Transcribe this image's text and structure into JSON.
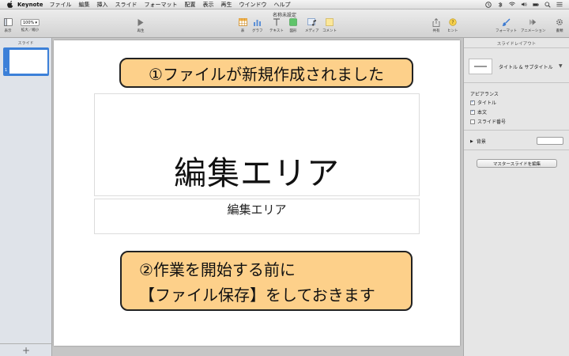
{
  "menubar": {
    "app_name": "Keynote",
    "items": [
      "ファイル",
      "編集",
      "挿入",
      "スライド",
      "フォーマット",
      "配置",
      "表示",
      "再生",
      "ウインドウ",
      "ヘルプ"
    ],
    "status_icons": [
      "clock-icon",
      "bluetooth-icon",
      "wifi-icon",
      "volume-icon",
      "battery-icon",
      "spotlight-icon",
      "notification-icon"
    ]
  },
  "window": {
    "title": "名称未設定"
  },
  "toolbar": {
    "view_label": "表示",
    "zoom_value": "100%",
    "zoom_label": "拡大／縮小",
    "play_label": "再生",
    "table_label": "表",
    "chart_label": "グラフ",
    "text_label": "テキスト",
    "shape_label": "図形",
    "media_label": "メディア",
    "comment_label": "コメント",
    "share_label": "共有",
    "tips_label": "ヒント",
    "format_label": "フォーマット",
    "animate_label": "アニメーション",
    "document_label": "書類"
  },
  "navigator": {
    "title": "スライド",
    "slide_number": "1",
    "add_label": "+"
  },
  "slide": {
    "title_placeholder": "編集エリア",
    "subtitle_placeholder": "編集エリア",
    "callout1": "①ファイルが新規作成されました",
    "callout2_line1": "②作業を開始する前に",
    "callout2_line2": "【ファイル保存】をしておきます"
  },
  "inspector": {
    "title": "スライドレイアウト",
    "layout_name": "タイトル & サブタイトル",
    "appearance_heading": "アピアランス",
    "checkbox_title": "タイトル",
    "checkbox_body": "本文",
    "checkbox_slide_number": "スライド番号",
    "background_label": "背景",
    "master_button": "マスタースライドを編集"
  },
  "colors": {
    "callout_fill": "#fdd08a",
    "selection_blue": "#3c80d8"
  }
}
